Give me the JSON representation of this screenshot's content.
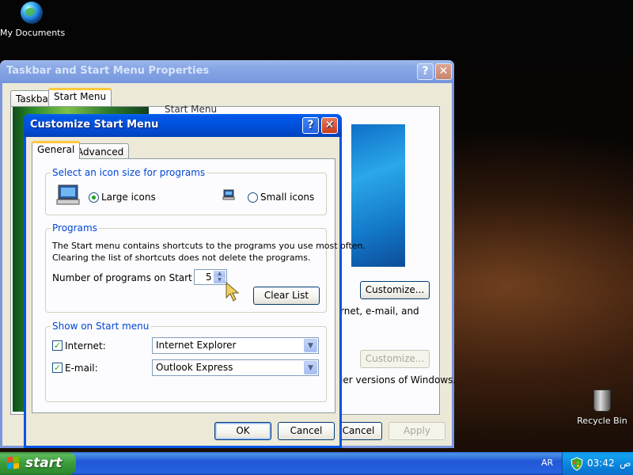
{
  "desktop": {
    "my_documents": "My Documents",
    "recycle_bin": "Recycle Bin"
  },
  "back_window": {
    "title": "Taskbar and Start Menu Properties",
    "tabs": [
      "Taskbar",
      "Start Menu"
    ],
    "help_label": "?",
    "close_label": "✕",
    "start_menu_label": "Start Menu",
    "customize1": "Customize...",
    "customize2": "Customize...",
    "desc_text": "rnet, e-mail, and",
    "classic_text": "ier versions of Windows.",
    "cancel": "Cancel",
    "apply": "Apply"
  },
  "dialog": {
    "title": "Customize Start Menu",
    "help_label": "?",
    "close_label": "✕",
    "tabs": [
      "General",
      "Advanced"
    ],
    "icon_size": {
      "legend": "Select an icon size for programs",
      "large": "Large icons",
      "small": "Small icons",
      "selected": "large"
    },
    "programs": {
      "legend": "Programs",
      "description_line1": "The Start menu contains shortcuts to the programs you use most often.",
      "description_line2": "Clearing the list of shortcuts does not delete the programs.",
      "count_label": "Number of programs on Start menu:",
      "count_value": "5",
      "clear_list": "Clear List"
    },
    "show_on_start": {
      "legend": "Show on Start menu",
      "internet_label": "Internet:",
      "internet_checked": true,
      "internet_value": "Internet Explorer",
      "email_label": "E-mail:",
      "email_checked": true,
      "email_value": "Outlook Express"
    },
    "ok": "OK",
    "cancel": "Cancel"
  },
  "taskbar": {
    "start": "start",
    "language": "AR",
    "clock_time": "03:42",
    "clock_ampm": "ص"
  },
  "colors": {
    "xp_blue": "#0055e5",
    "start_green": "#3a9b3a",
    "legend_blue": "#0046d5"
  }
}
